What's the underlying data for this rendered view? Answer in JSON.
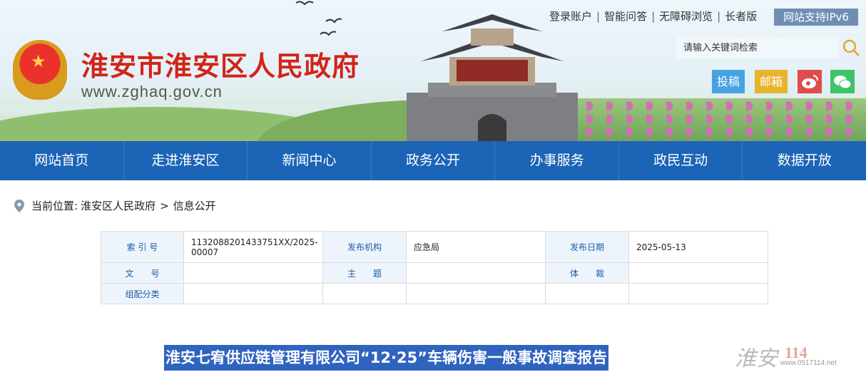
{
  "header": {
    "site_name": "淮安市淮安区人民政府",
    "site_url": "www.zghaq.gov.cn",
    "top_links": [
      "登录账户",
      "智能问答",
      "无障碍浏览",
      "长者版"
    ],
    "ipv6_label": "网站支持IPv6",
    "search_placeholder": "请输入关键词检索",
    "buttons": {
      "contribute": "投稿",
      "mailbox": "邮箱"
    },
    "colors": {
      "brand_red": "#d22418",
      "nav_blue": "#1c64b6",
      "contribute_bg": "#46a2e0",
      "mailbox_bg": "#e7b42d",
      "weibo_bg": "#e04b4b",
      "wechat_bg": "#3ec26a"
    }
  },
  "nav": [
    "网站首页",
    "走进淮安区",
    "新闻中心",
    "政务公开",
    "办事服务",
    "政民互动",
    "数据开放"
  ],
  "breadcrumb": {
    "label": "当前位置:",
    "items": [
      "淮安区人民政府",
      "信息公开"
    ],
    "separator": ">"
  },
  "meta_table": {
    "rows": [
      [
        {
          "label": "索 引 号",
          "value": "1132088201433751XX/2025-00007"
        },
        {
          "label": "发布机构",
          "value": "应急局"
        },
        {
          "label": "发布日期",
          "value": "2025-05-13"
        }
      ],
      [
        {
          "label": "文　　号",
          "value": ""
        },
        {
          "label": "主　　题",
          "value": ""
        },
        {
          "label": "体　　裁",
          "value": ""
        }
      ],
      [
        {
          "label": "组配分类",
          "value": ""
        },
        {
          "label": "",
          "value": ""
        },
        {
          "label": "",
          "value": ""
        }
      ]
    ]
  },
  "article": {
    "title": "淮安七宥供应链管理有限公司“12·25”车辆伤害一般事故调查报告"
  },
  "watermark": {
    "text": "淮安",
    "number": "114",
    "url": "www.0517114.net"
  }
}
